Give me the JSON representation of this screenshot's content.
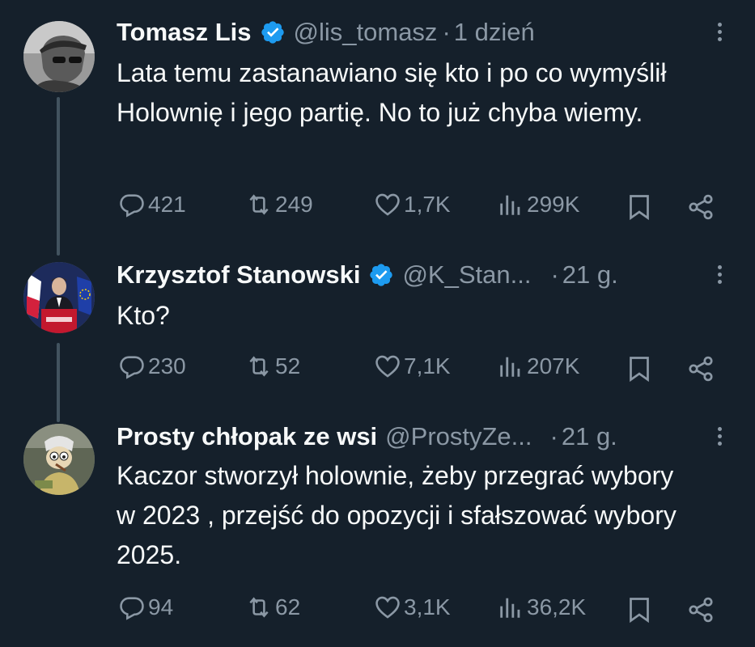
{
  "tweets": [
    {
      "name": "Tomasz Lis",
      "handle": "@lis_tomasz",
      "separator": "·",
      "time": "1 dzień",
      "text": "Lata temu zastanawiano się kto i po co wymyślił Holownię i jego partię. No to już chyba wiemy.",
      "replies": "421",
      "retweets": "249",
      "likes": "1,7K",
      "views": "299K",
      "avatar_icon": "man-with-sunglasses-avatar"
    },
    {
      "name": "Krzysztof Stanowski",
      "handle": "@K_Stan...",
      "separator": "·",
      "time": "21 g.",
      "text": "Kto?",
      "replies": "230",
      "retweets": "52",
      "likes": "7,1K",
      "views": "207K",
      "avatar_icon": "man-at-podium-with-flags-avatar"
    },
    {
      "name": "Prosty chłopak ze wsi",
      "handle": "@ProstyZe...",
      "separator": "·",
      "time": "21 g.",
      "text": "Kaczor stworzył holownie, żeby przegrać wybory w 2023 , przejść do opozycji i sfałszować wybory 2025.",
      "replies": "94",
      "retweets": "62",
      "likes": "3,1K",
      "views": "36,2K",
      "avatar_icon": "cartoon-character-avatar"
    }
  ],
  "colors": {
    "background": "#15202b",
    "text": "#f7f9f9",
    "muted": "#8b98a5",
    "verified": "#1d9bf0",
    "thread_line": "#42535f"
  }
}
